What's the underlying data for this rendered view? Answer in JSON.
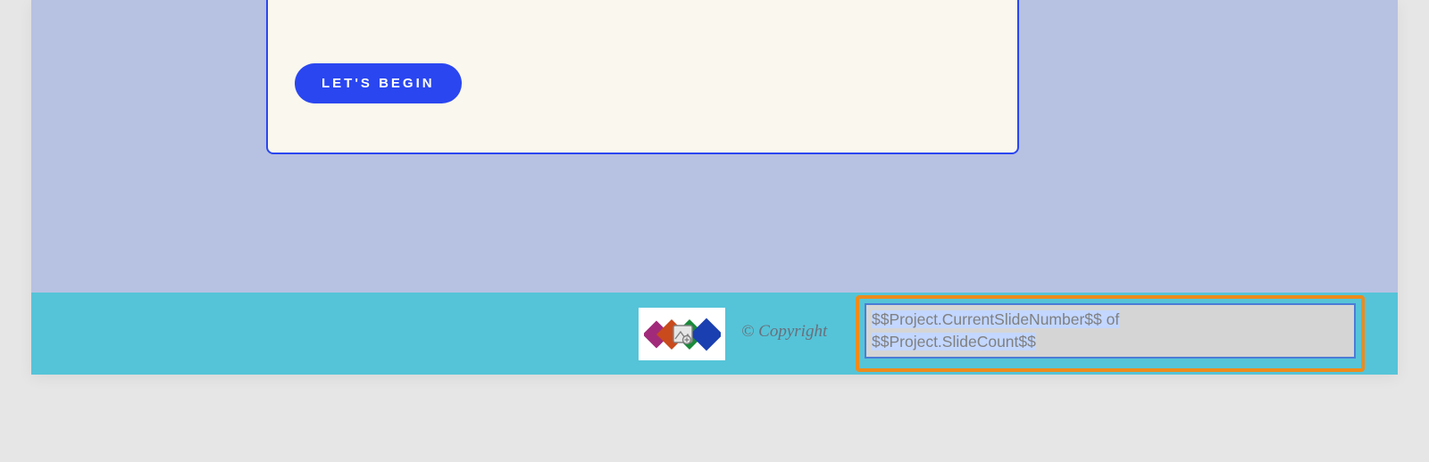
{
  "card": {
    "button_label": "LET'S BEGIN"
  },
  "footer": {
    "copyright": "© Copyright",
    "variable_text": {
      "line1a": "$$Project.CurrentSlideNumber$$",
      "line1b": " of",
      "line2": "$$Project.SlideCount$$"
    },
    "logo": {
      "icon_name": "diamonds-image-placeholder-icon"
    }
  }
}
